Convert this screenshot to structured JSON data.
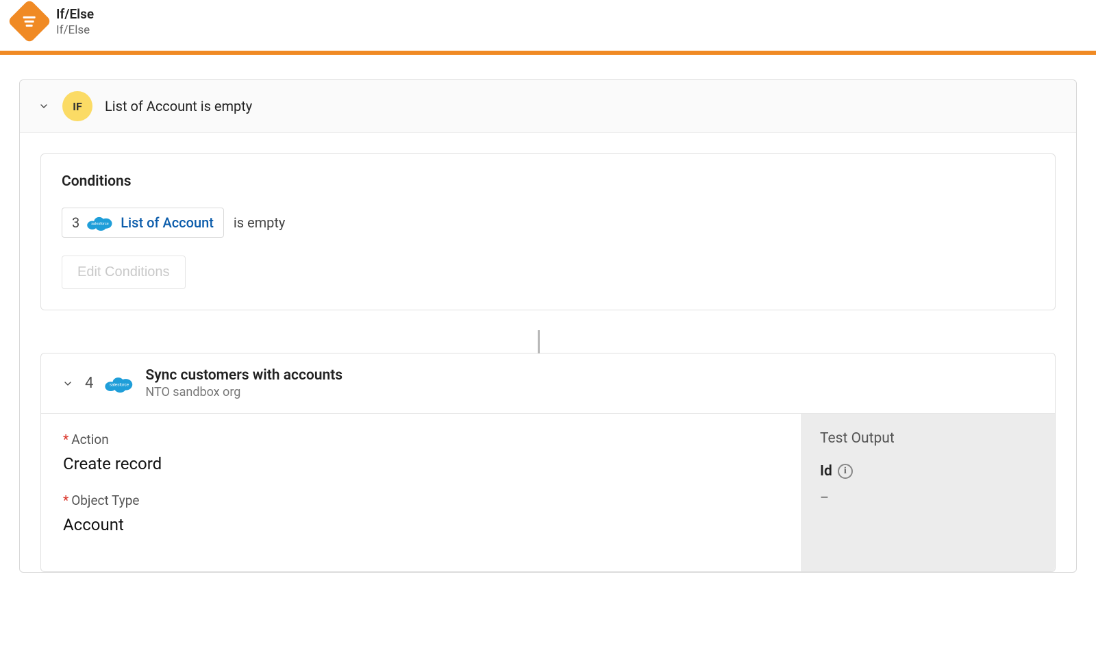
{
  "header": {
    "title": "If/Else",
    "subtitle": "If/Else"
  },
  "if_block": {
    "badge_label": "IF",
    "title": "List of Account is empty",
    "conditions_heading": "Conditions",
    "condition": {
      "step_number": "3",
      "token_label": "List of Account",
      "operator": "is empty"
    },
    "edit_button_label": "Edit Conditions"
  },
  "step_block": {
    "step_number": "4",
    "title": "Sync customers with accounts",
    "subtitle": "NTO sandbox org",
    "fields": {
      "action": {
        "label": "Action",
        "value": "Create record",
        "required": true
      },
      "object_type": {
        "label": "Object Type",
        "value": "Account",
        "required": true
      }
    },
    "test_output": {
      "heading": "Test Output",
      "id_label": "Id",
      "id_value": "–"
    }
  }
}
